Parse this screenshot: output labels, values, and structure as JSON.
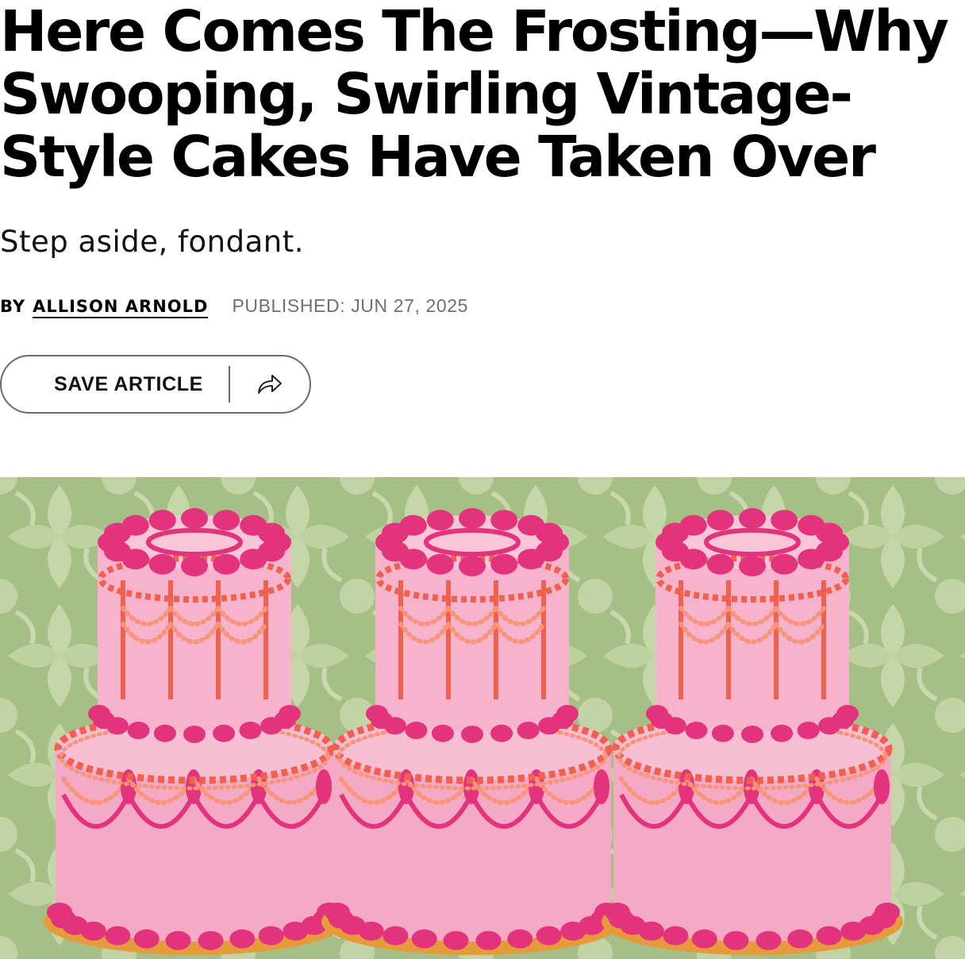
{
  "article": {
    "headline_lines": [
      "Here Comes The Frosting—Why",
      "Swooping, Swirling Vintage-",
      "Style Cakes Have Taken Over"
    ],
    "dek": "Step aside, fondant.",
    "byline": {
      "by_label": "BY",
      "author": "ALLISON ARNOLD",
      "published": "PUBLISHED: JUN 27, 2025"
    }
  },
  "actions": {
    "save_label": "SAVE ARTICLE",
    "share_icon": "share-arrow-icon"
  },
  "hero_image": {
    "subject": "three-two-tier-pink-vintage-piped-cakes",
    "colors": {
      "background": "#a6bf86",
      "pattern": "#c9d9ad",
      "cake_base": "#f4a9c4",
      "piping_magenta": "#e2337c",
      "piping_coral": "#f0604f",
      "piping_peach": "#f7957a",
      "board": "#e59a3c"
    }
  }
}
